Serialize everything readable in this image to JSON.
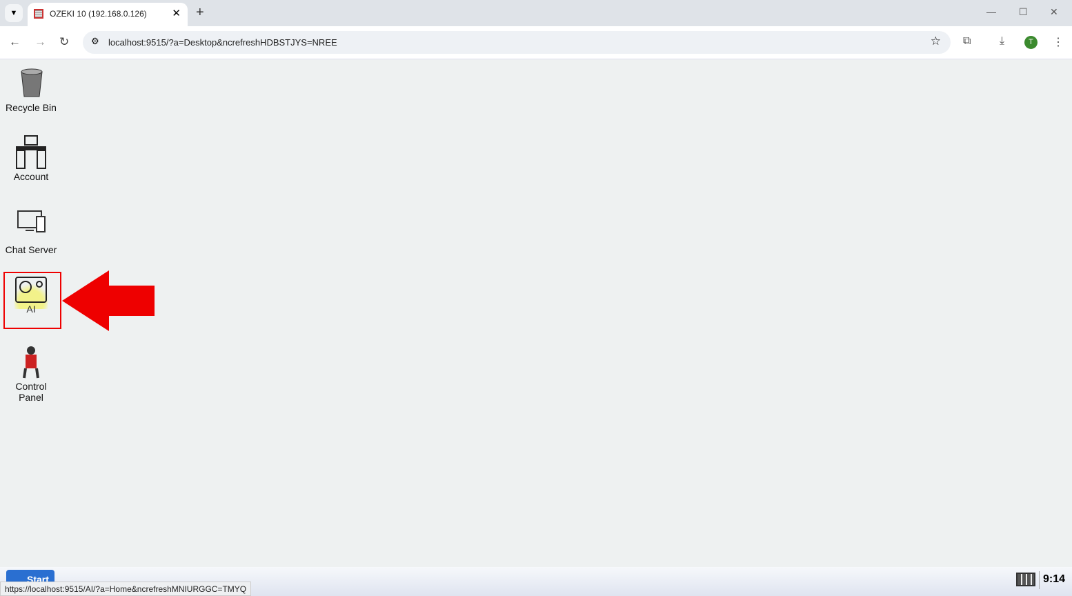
{
  "browser": {
    "tab_title": "OZEKI 10 (192.168.0.126)",
    "url": "localhost:9515/?a=Desktop&ncrefreshHDBSTJYS=NREE",
    "profile_initial": "T"
  },
  "desktop": {
    "icons": [
      {
        "label": "Recycle Bin"
      },
      {
        "label": "Account"
      },
      {
        "label": "Chat Server"
      },
      {
        "label": "AI"
      },
      {
        "label": "Control Panel"
      }
    ]
  },
  "taskbar": {
    "start_label": "Start",
    "clock": "9:14"
  },
  "status_url": "https://localhost:9515/AI/?a=Home&ncrefreshMNIURGGC=TMYQ",
  "colors": {
    "highlight": "#e00000"
  }
}
